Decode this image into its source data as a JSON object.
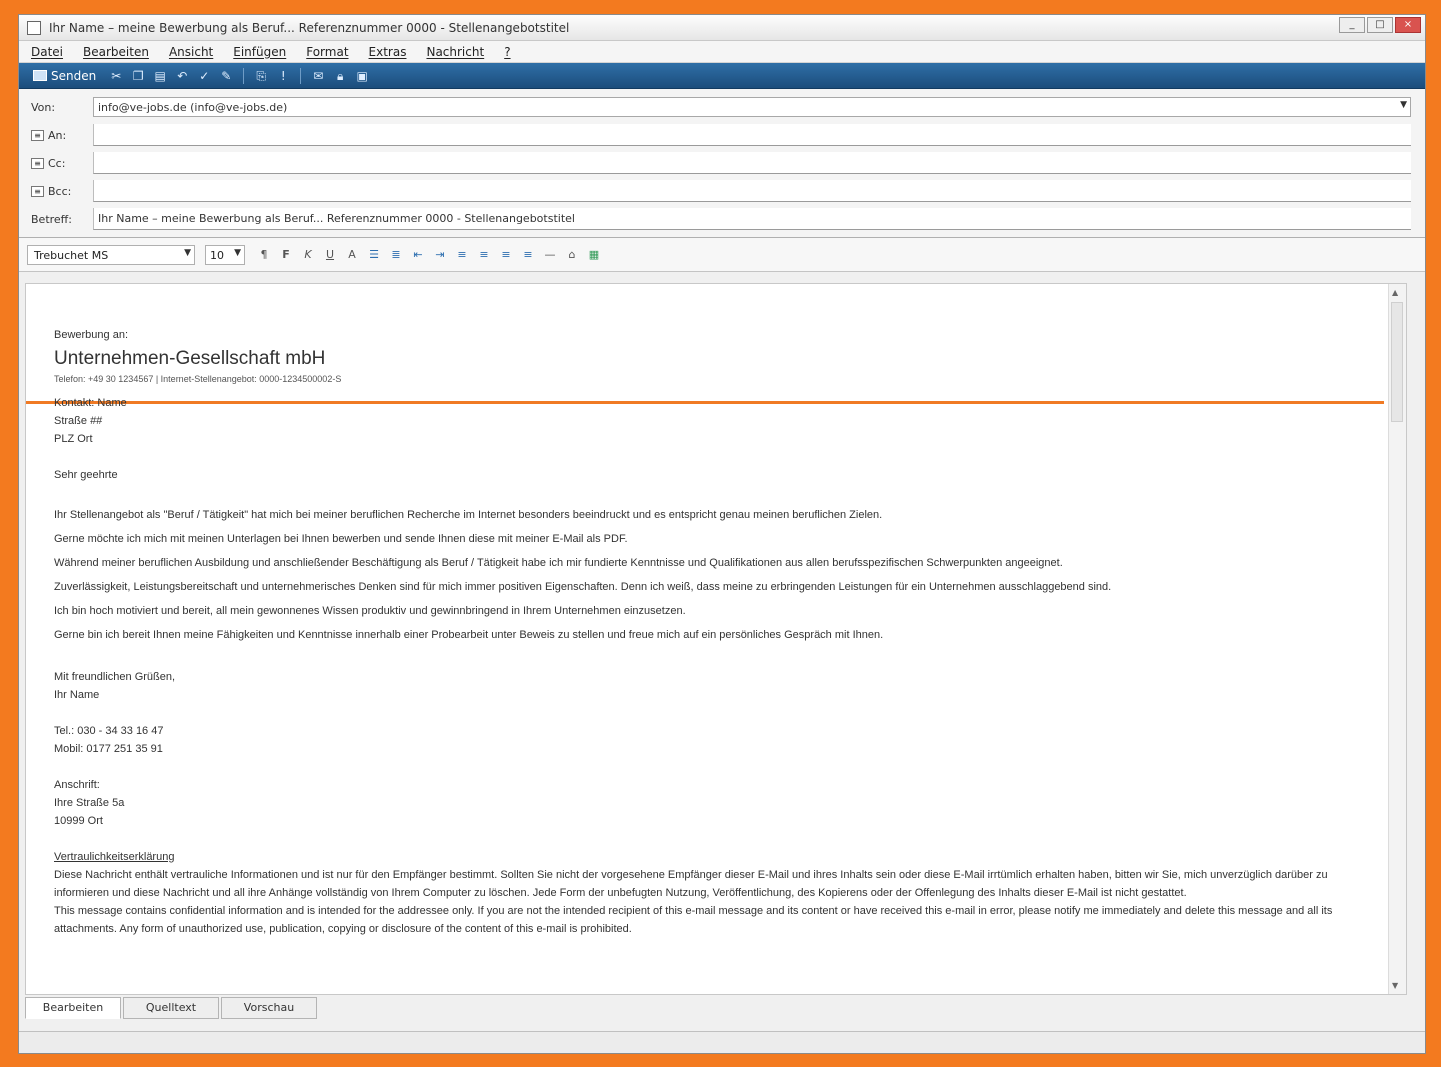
{
  "window": {
    "title": "Ihr Name – meine Bewerbung als Beruf... Referenznummer 0000 - Stellenangebotstitel",
    "controls": [
      "_",
      "□",
      "×"
    ]
  },
  "menu": [
    "Datei",
    "Bearbeiten",
    "Ansicht",
    "Einfügen",
    "Format",
    "Extras",
    "Nachricht",
    "?"
  ],
  "toolbar": {
    "send_label": "Senden",
    "icons": [
      "cut-icon",
      "copy-icon",
      "paste-icon",
      "undo-icon",
      "check-names-icon",
      "spell-icon",
      "attach-icon",
      "priority-icon",
      "sign-icon",
      "encrypt-icon",
      "offline-icon"
    ]
  },
  "header": {
    "from_label": "Von:",
    "from_value": "info@ve-jobs.de   (info@ve-jobs.de)",
    "to_label": "An:",
    "cc_label": "Cc:",
    "bcc_label": "Bcc:",
    "subject_label": "Betreff:",
    "subject_value": "Ihr Name – meine Bewerbung als Beruf... Referenznummer 0000 - Stellenangebotstitel"
  },
  "format": {
    "font": "Trebuchet MS",
    "size": "10"
  },
  "body": {
    "intro": "Bewerbung an:",
    "company": "Unternehmen-Gesellschaft mbH",
    "contact_info": "Telefon: +49 30 1234567 | Internet-Stellenangebot: 0000-1234500002-S",
    "recipient": [
      "Kontakt: Name",
      "Straße ##",
      "PLZ Ort"
    ],
    "salutation": "Sehr geehrte",
    "paragraphs": [
      "Ihr Stellenangebot als \"Beruf / Tätigkeit\" hat mich bei meiner beruflichen Recherche im Internet besonders beeindruckt und es entspricht genau meinen beruflichen Zielen.",
      "Gerne möchte ich mich mit meinen Unterlagen bei Ihnen bewerben und sende Ihnen diese mit meiner E-Mail als PDF.",
      "Während meiner beruflichen Ausbildung und anschließender Beschäftigung als Beruf / Tätigkeit  habe ich mir fundierte Kenntnisse und Qualifikationen aus allen berufsspezifischen Schwerpunkten angeeignet.",
      "Zuverlässigkeit, Leistungsbereitschaft und unternehmerisches Denken sind für mich immer positiven Eigenschaften. Denn ich weiß, dass meine zu erbringenden Leistungen für ein Unternehmen ausschlaggebend sind.",
      "Ich bin hoch motiviert und bereit, all mein gewonnenes Wissen produktiv und gewinnbringend in Ihrem Unternehmen einzusetzen.",
      "Gerne bin ich bereit Ihnen meine Fähigkeiten und Kenntnisse innerhalb einer Probearbeit unter Beweis zu stellen und freue mich auf ein persönliches Gespräch mit Ihnen."
    ],
    "closing": [
      "Mit freundlichen Grüßen,",
      "Ihr Name"
    ],
    "phone": [
      "Tel.: 030 - 34 33 16 47",
      "Mobil: 0177 251 35 91"
    ],
    "address_title": "Anschrift:",
    "address": [
      "Ihre Straße 5a",
      "10999 Ort"
    ],
    "confidentiality_title": "Vertraulichkeitserklärung",
    "confidentiality_de": "Diese Nachricht enthält vertrauliche Informationen und ist nur für den Empfänger bestimmt. Sollten Sie nicht der vorgesehene Empfänger dieser E-Mail und ihres Inhalts sein oder diese E-Mail irrtümlich erhalten haben, bitten wir Sie, mich unverzüglich darüber zu informieren und diese Nachricht und all ihre Anhänge vollständig von Ihrem Computer zu löschen. Jede Form der unbefugten Nutzung, Veröffentlichung, des Kopierens oder der Offenlegung des Inhalts dieser E-Mail ist nicht gestattet.",
    "confidentiality_en": "This message contains confidential information and is intended for the addressee only. If you are not the intended recipient of this e-mail message and its content or have received this e-mail in error, please notify me immediately and delete this message and all its attachments. Any form of unauthorized use, publication, copying or disclosure of the content of this e-mail is prohibited."
  },
  "tabs": [
    "Bearbeiten",
    "Quelltext",
    "Vorschau"
  ],
  "colors": {
    "accent": "#f07a24",
    "toolbar": "#1c4d7c",
    "frame": "#f37a1f"
  }
}
